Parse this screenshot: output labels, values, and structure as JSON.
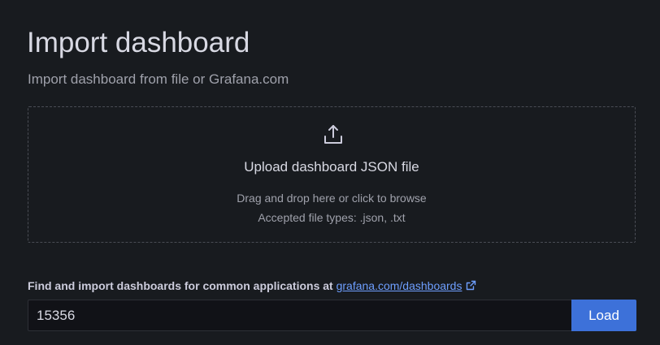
{
  "header": {
    "title": "Import dashboard",
    "subtitle": "Import dashboard from file or Grafana.com"
  },
  "upload": {
    "icon": "upload-icon",
    "title": "Upload dashboard JSON file",
    "hint_drag": "Drag and drop here or click to browse",
    "hint_types": "Accepted file types: .json, .txt"
  },
  "grafana_com": {
    "label": "Find and import dashboards for common applications at",
    "link_text": "grafana.com/dashboards",
    "link_icon": "external-link-icon",
    "input_value": "15356",
    "load_label": "Load"
  },
  "colors": {
    "background": "#181b1f",
    "link": "#6e9fff",
    "primary_button": "#3d71d9",
    "input_background": "#111217"
  }
}
